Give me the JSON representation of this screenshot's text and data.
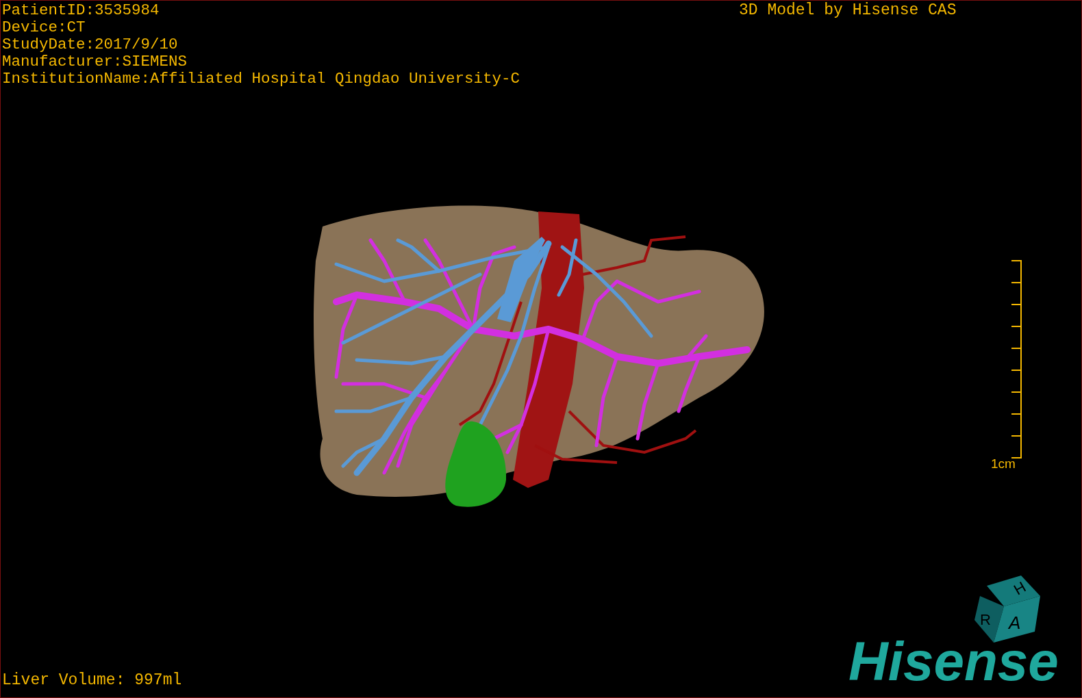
{
  "patient_info": [
    "PatientID:3535984",
    "Device:CT",
    "StudyDate:2017/9/10",
    "Manufacturer:SIEMENS",
    "InstitutionName:Affiliated Hospital Qingdao University-C"
  ],
  "title": "3D Model by Hisense CAS",
  "scale_bar": {
    "label": "1cm"
  },
  "orientation_cube": {
    "faces": [
      "H",
      "R",
      "A"
    ]
  },
  "liver_volume": "Liver Volume: 997ml",
  "logo": "Hisense"
}
